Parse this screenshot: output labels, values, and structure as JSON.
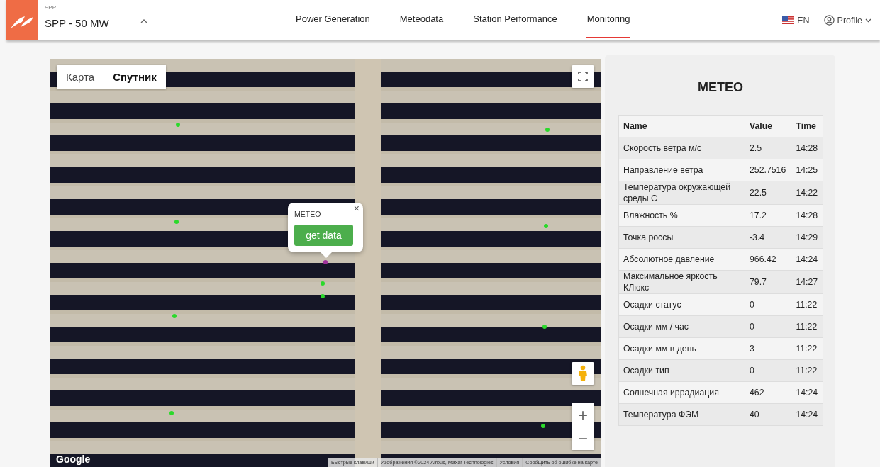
{
  "header": {
    "plant_caption": "SPP",
    "plant_name": "SPP - 50 MW",
    "language": "EN",
    "profile": "Profile"
  },
  "tabs": [
    {
      "label": "Power Generation",
      "selected": false
    },
    {
      "label": "Meteodata",
      "selected": false
    },
    {
      "label": "Station Performance",
      "selected": false
    },
    {
      "label": "Monitoring",
      "selected": true
    }
  ],
  "map": {
    "map_types": [
      {
        "label": "Карта",
        "selected": false
      },
      {
        "label": "Спутник",
        "selected": true
      }
    ],
    "popup": {
      "title": "METEO",
      "close": "×",
      "button": "get data"
    },
    "zoom_in": "+",
    "zoom_out": "−",
    "logo": "Google",
    "attribution": [
      "Быстрые клавиши",
      "Изображения ©2024 Airbus, Maxar Technologies",
      "Условия",
      "Сообщить об ошибке на карте"
    ]
  },
  "meteo": {
    "title": "METEO",
    "columns": [
      "Name",
      "Value",
      "Time"
    ],
    "rows": [
      [
        "Скорость ветра м/с",
        "2.5",
        "14:28"
      ],
      [
        "Направление ветра",
        "252.7516",
        "14:25"
      ],
      [
        "Температура окружающей среды С",
        "22.5",
        "14:22"
      ],
      [
        "Влажность %",
        "17.2",
        "14:28"
      ],
      [
        "Точка россы",
        "-3.4",
        "14:29"
      ],
      [
        "Абсолютное давление",
        "966.42",
        "14:24"
      ],
      [
        "Максимальное яркость КЛюкс",
        "79.7",
        "14:27"
      ],
      [
        "Осадки статус",
        "0",
        "11:22"
      ],
      [
        "Осадки мм / час",
        "0",
        "11:22"
      ],
      [
        "Осадки мм в день",
        "3",
        "11:22"
      ],
      [
        "Осадки тип",
        "0",
        "11:22"
      ],
      [
        "Солнечная иррадиация",
        "462",
        "14:24"
      ],
      [
        "Температура ФЭМ",
        "40",
        "14:24"
      ]
    ]
  }
}
